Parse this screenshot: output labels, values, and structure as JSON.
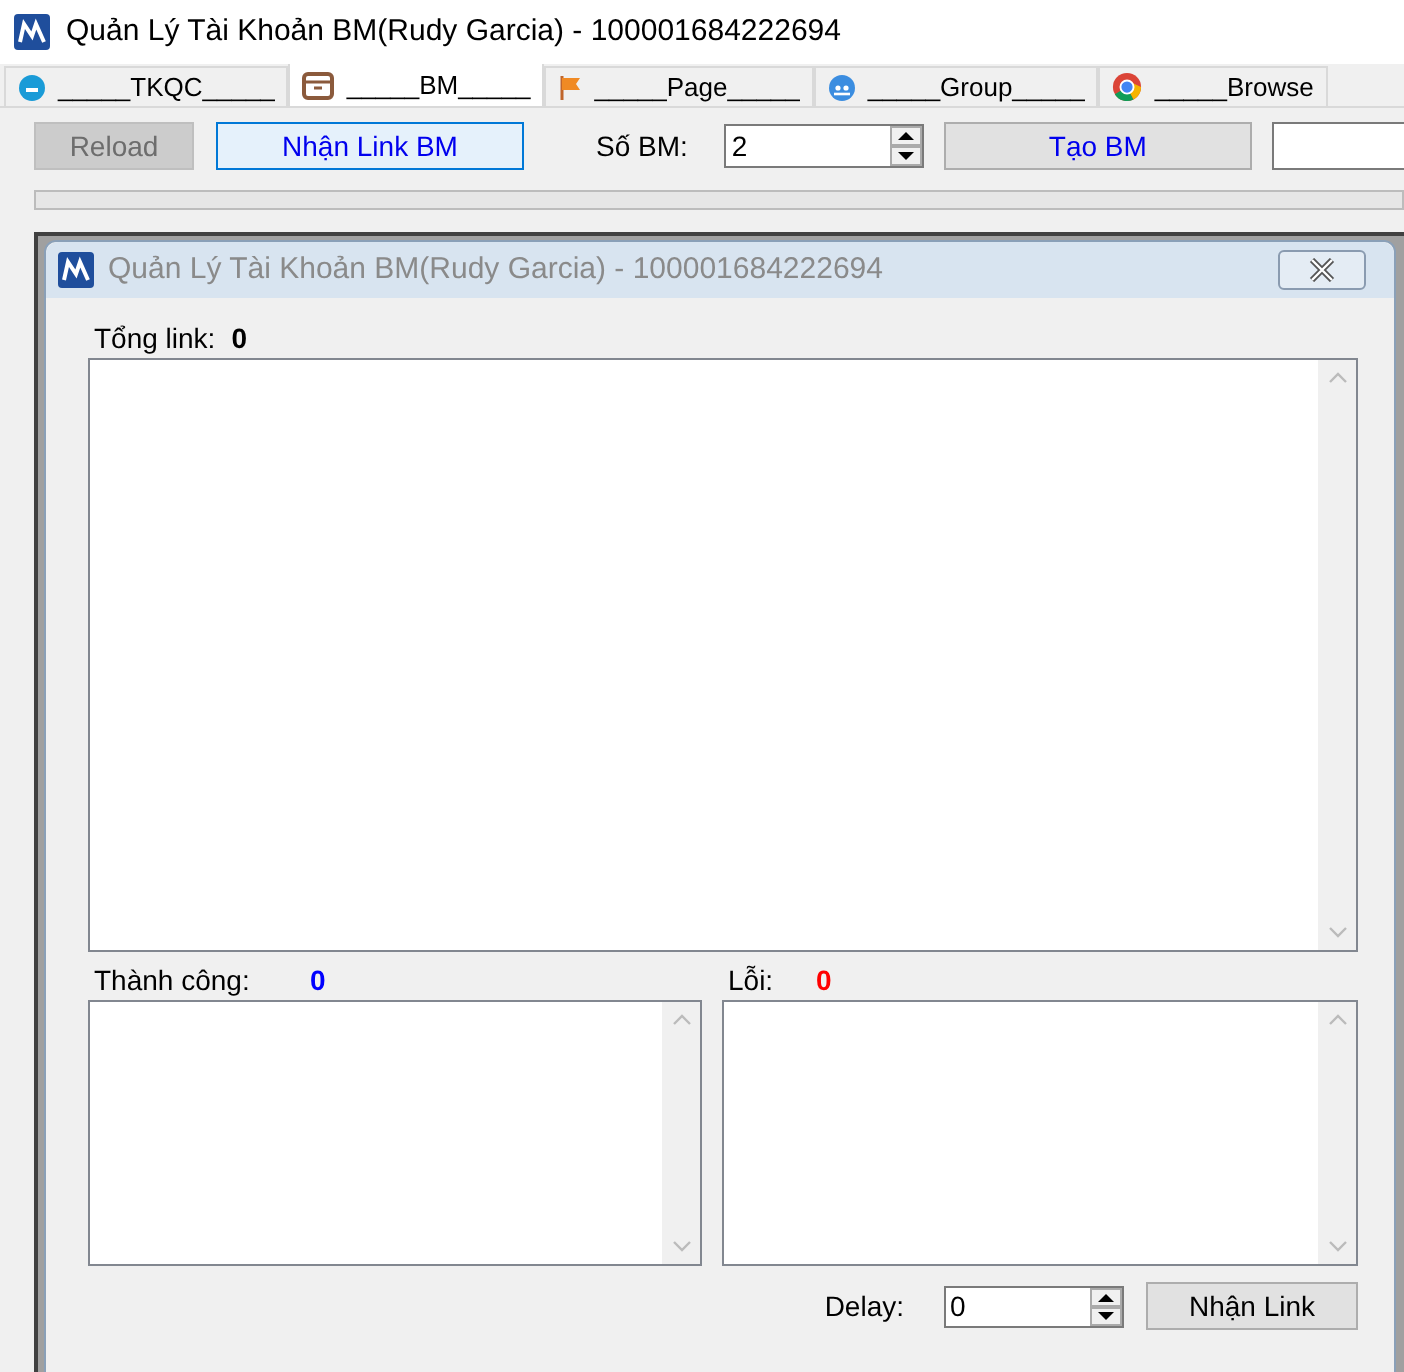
{
  "window": {
    "title": "Quản Lý Tài Khoản BM(Rudy Garcia) - 100001684222694"
  },
  "tabs": [
    {
      "label": "_____TKQC_____",
      "selected": false
    },
    {
      "label": "_____BM_____",
      "selected": true
    },
    {
      "label": "_____Page_____",
      "selected": false
    },
    {
      "label": "_____Group_____",
      "selected": false
    },
    {
      "label": "_____Browse",
      "selected": false
    }
  ],
  "toolbar": {
    "reload_button": {
      "label": "Reload",
      "disabled": true
    },
    "get_link_button": {
      "label": "Nhận Link BM"
    },
    "bm_count": {
      "label": "Số BM:",
      "value": "2"
    },
    "create_button": {
      "label": "Tạo BM"
    }
  },
  "progress": {
    "level": 0
  },
  "dialog": {
    "title": "Quản Lý Tài Khoản BM(Rudy Garcia) - 100001684222694",
    "total": {
      "label": "Tổng link:",
      "value": "0"
    },
    "success": {
      "label": "Thành công:",
      "value": "0"
    },
    "errors": {
      "label": "Lỗi:",
      "value": "0"
    },
    "delay": {
      "label": "Delay:",
      "value": "0"
    },
    "button": "Nhận Link"
  }
}
